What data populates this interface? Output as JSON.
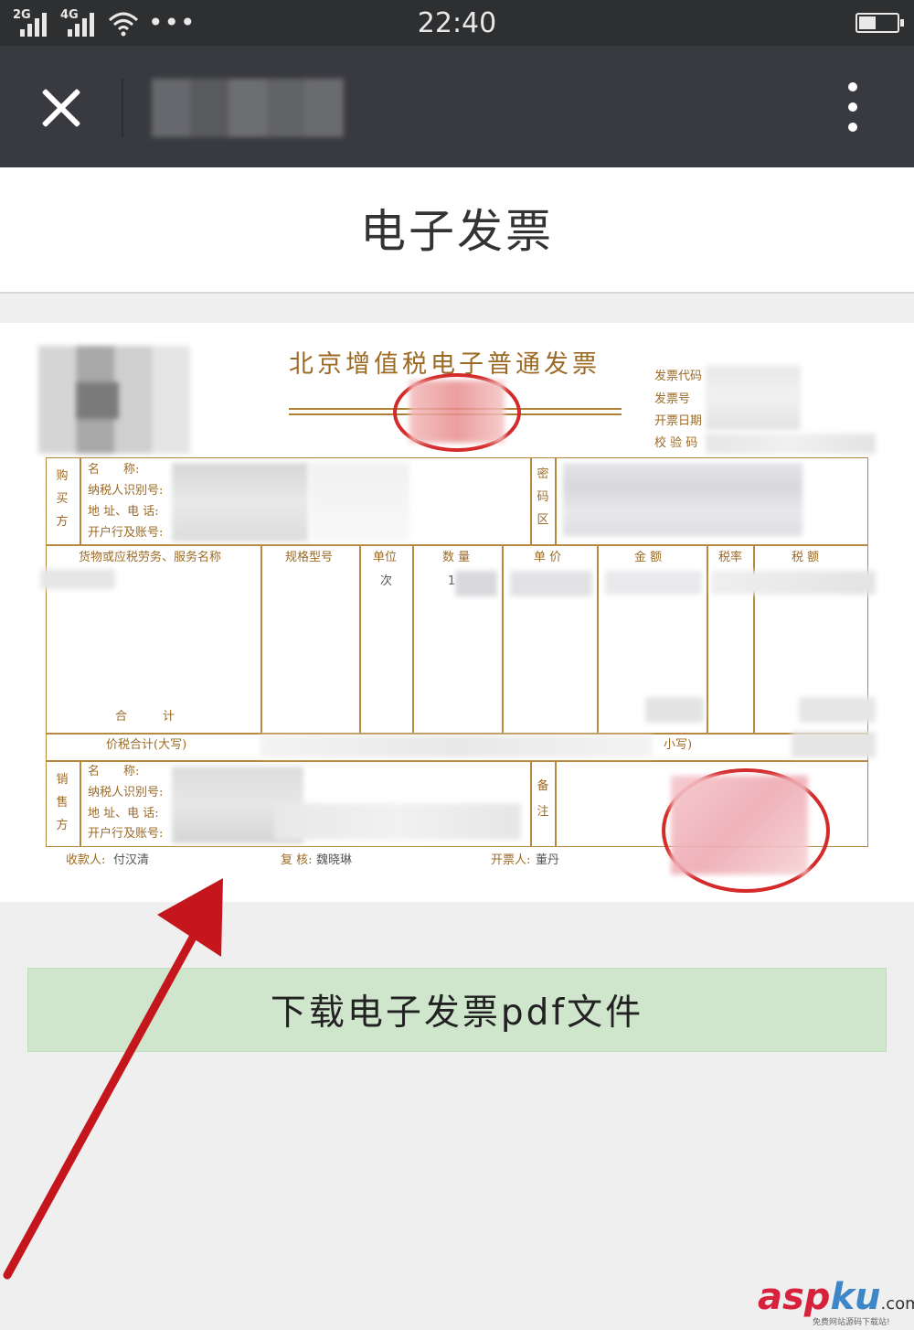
{
  "status_bar": {
    "network_1": "2G",
    "network_2": "4G",
    "more": "•••",
    "time": "22:40"
  },
  "title_bar": {
    "close_icon": "close-icon",
    "more_icon": "kebab-menu-icon"
  },
  "page": {
    "title": "电子发票"
  },
  "invoice": {
    "title": "北京增值税电子普通发票",
    "meta_labels": [
      "发票代码",
      "发票号",
      "开票日期",
      "校 验 码"
    ],
    "buyer_section": "购买方",
    "buyer_labels": [
      "名　　称:",
      "纳税人识别号:",
      "地 址、电 话:",
      "开户行及账号:"
    ],
    "password_section": "密码区",
    "columns": [
      "货物或应税劳务、服务名称",
      "规格型号",
      "单位",
      "数 量",
      "单 价",
      "金 额",
      "税率",
      "税 额"
    ],
    "unit_value": "次",
    "quantity_value": "1",
    "subtotal_label": "合　　　计",
    "total_label": "价税合计(大写)",
    "small_label": "小写)",
    "seller_section": "销售方",
    "seller_labels": [
      "名　　称:",
      "纳税人识别号:",
      "地 址、电 话:",
      "开户行及账号:"
    ],
    "remark_section": "备注",
    "payee_label": "收款人:",
    "payee_value": "付汉清",
    "reviewer_label": "复 核:",
    "reviewer_value": "魏晓琳",
    "issuer_label": "开票人:",
    "issuer_value": "董丹"
  },
  "download_button": {
    "label": "下载电子发票pdf文件",
    "color": "#cfe6cc"
  },
  "annotation": {
    "arrow_color": "#c4161c"
  },
  "watermark": {
    "brand_a": "asp",
    "brand_b": "ku",
    "brand_c": ".com",
    "tagline": "免费网站源码下载站!"
  }
}
